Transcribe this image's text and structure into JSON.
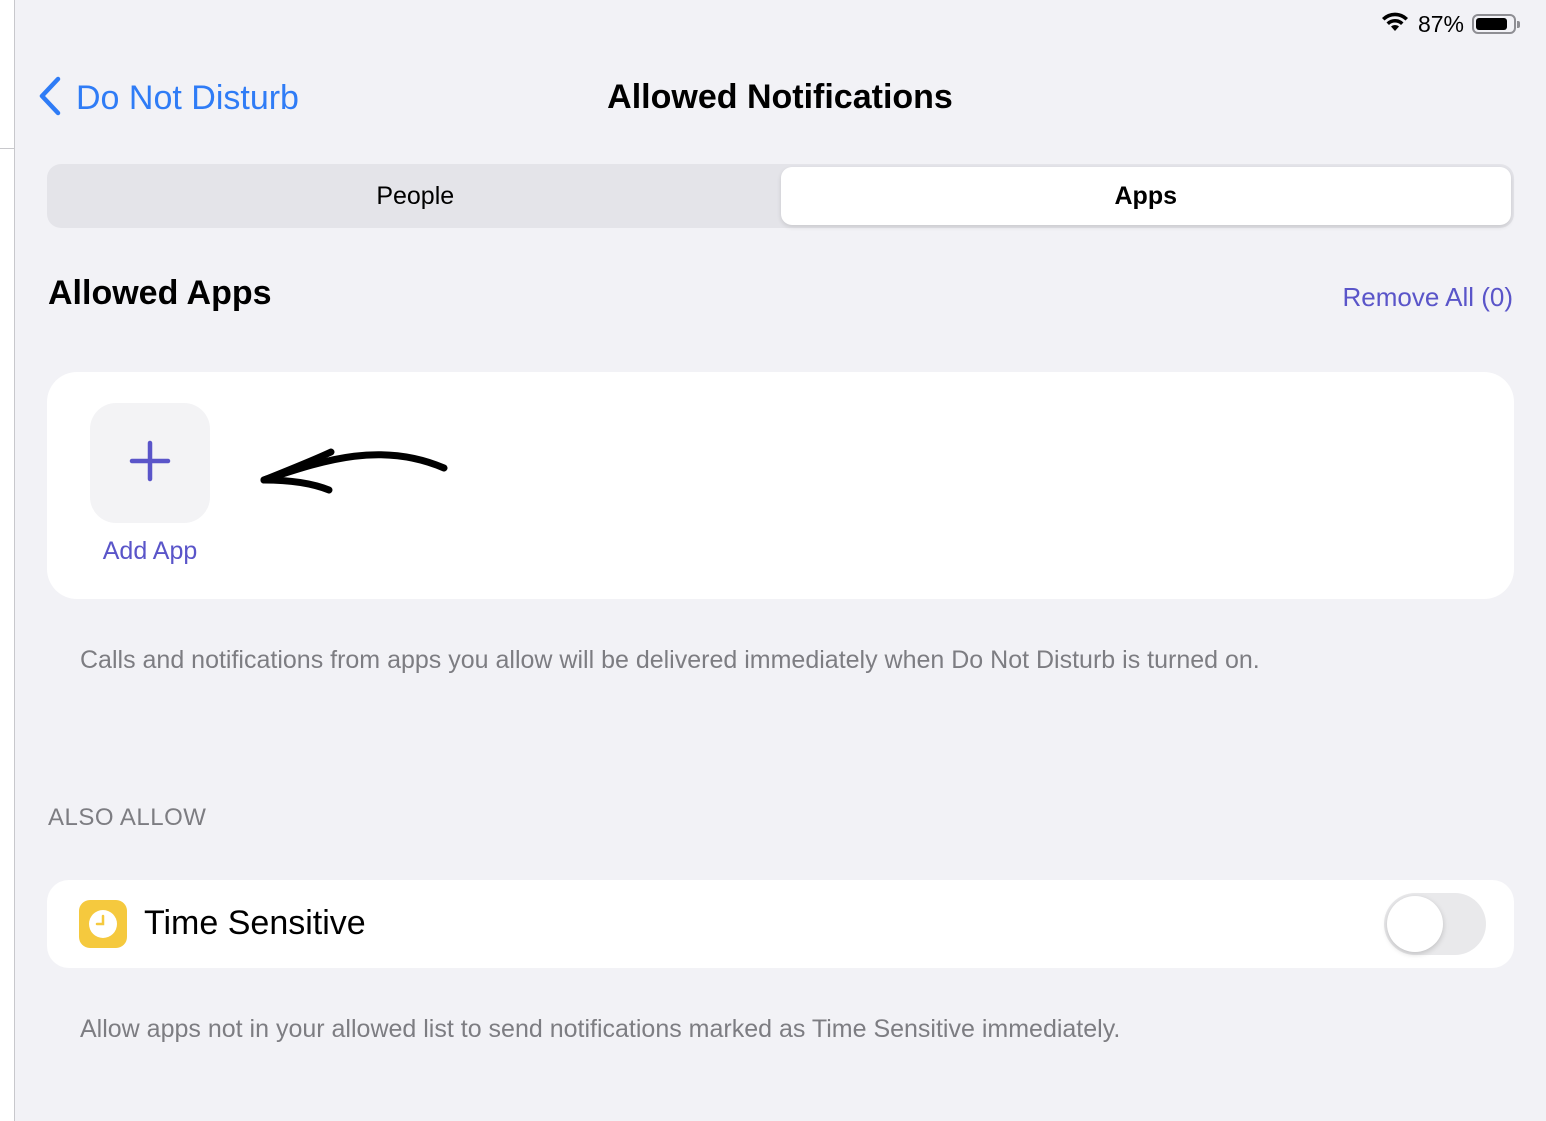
{
  "status_bar": {
    "battery_percent_label": "87%",
    "battery_level": 0.87,
    "wifi_icon": "wifi-icon",
    "battery_icon": "battery-icon"
  },
  "nav": {
    "back_label": "Do Not Disturb",
    "back_icon": "chevron-left-icon",
    "title": "Allowed Notifications"
  },
  "segmented": {
    "segments": [
      {
        "label": "People",
        "selected": false
      },
      {
        "label": "Apps",
        "selected": true
      }
    ]
  },
  "allowed_apps": {
    "title": "Allowed Apps",
    "remove_all_label": "Remove All (0)",
    "add_app_label": "Add App",
    "add_icon": "plus-icon",
    "footer": "Calls and notifications from apps you allow will be delivered immediately when Do Not Disturb is turned on."
  },
  "also_allow": {
    "header": "ALSO ALLOW",
    "time_sensitive": {
      "label": "Time Sensitive",
      "icon": "clock-icon",
      "enabled": false
    },
    "footer": "Allow apps not in your allowed list to send notifications marked as Time Sensitive immediately."
  },
  "colors": {
    "background": "#f2f2f6",
    "accent_blue": "#2f7cf6",
    "accent_indigo": "#5a55c9",
    "secondary_text": "#7d7d82",
    "time_sensitive_icon": "#f5c93e"
  }
}
